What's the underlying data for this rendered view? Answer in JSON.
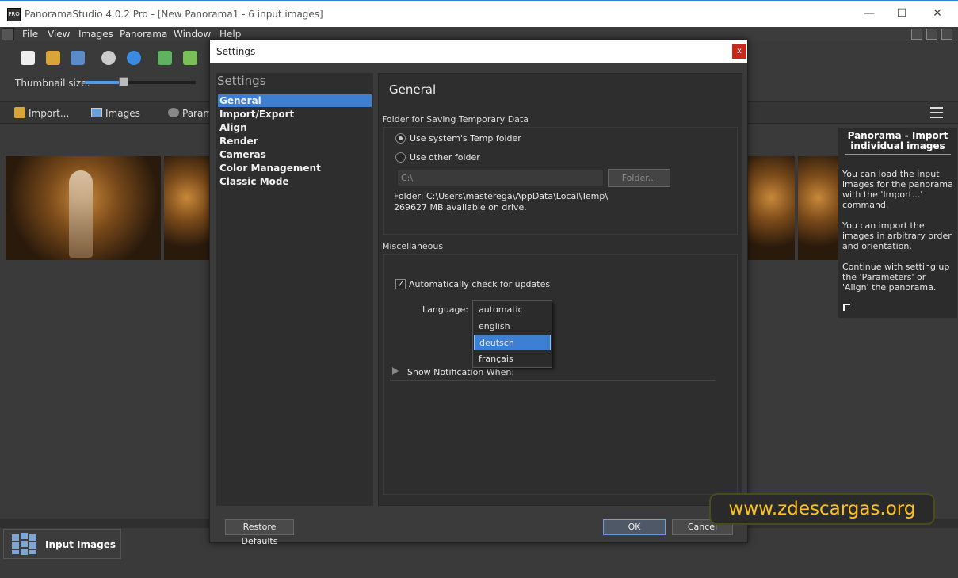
{
  "window": {
    "title": "PanoramaStudio 4.0.2 Pro - [New Panorama1 - 6 input images]",
    "app_icon_text": "PRO"
  },
  "menu": [
    "File",
    "View",
    "Images",
    "Panorama",
    "Window",
    "Help"
  ],
  "toolbar": {
    "thumbnail_label": "Thumbnail size:",
    "thumbnail_size_fraction": 0.35
  },
  "tabs": {
    "import": "Import...",
    "images": "Images",
    "parameters": "Param"
  },
  "help_panel": {
    "title": "Panorama - Import individual images",
    "paragraphs": [
      "You can load the input images for the panorama with the 'Import...' command.",
      "You can import the images in arbitrary order and orientation.",
      "Continue with setting up the 'Parameters' or 'Align' the panorama."
    ]
  },
  "bottom_tab": {
    "label": "Input Images"
  },
  "dialog": {
    "title": "Settings",
    "close": "x",
    "sidebar_heading": "Settings",
    "sidebar_items": [
      "General",
      "Import/Export",
      "Align",
      "Render",
      "Cameras",
      "Color Management",
      "Classic Mode"
    ],
    "active_item": "General",
    "content_title": "General",
    "temp_section": {
      "label": "Folder for Saving Temporary Data",
      "radio_system": "Use system's Temp folder",
      "radio_other": "Use other folder",
      "folder_value": "C:\\",
      "folder_button": "Folder...",
      "folder_info": "Folder: C:\\Users\\masterega\\AppData\\Local\\Temp\\",
      "available_info": "269627 MB available on drive."
    },
    "misc_section": {
      "label": "Miscellaneous",
      "auto_update": "Automatically check for updates",
      "auto_update_checked": true,
      "checkmark": "✓",
      "language_label": "Language:",
      "language_options": [
        "automatic",
        "english",
        "deutsch",
        "français"
      ],
      "language_selected": "deutsch",
      "notification_label": "Show Notification When:"
    },
    "buttons": {
      "restore": "Restore Defaults",
      "ok": "OK",
      "cancel": "Cancel"
    }
  },
  "watermark": "www.zdescargas.org"
}
